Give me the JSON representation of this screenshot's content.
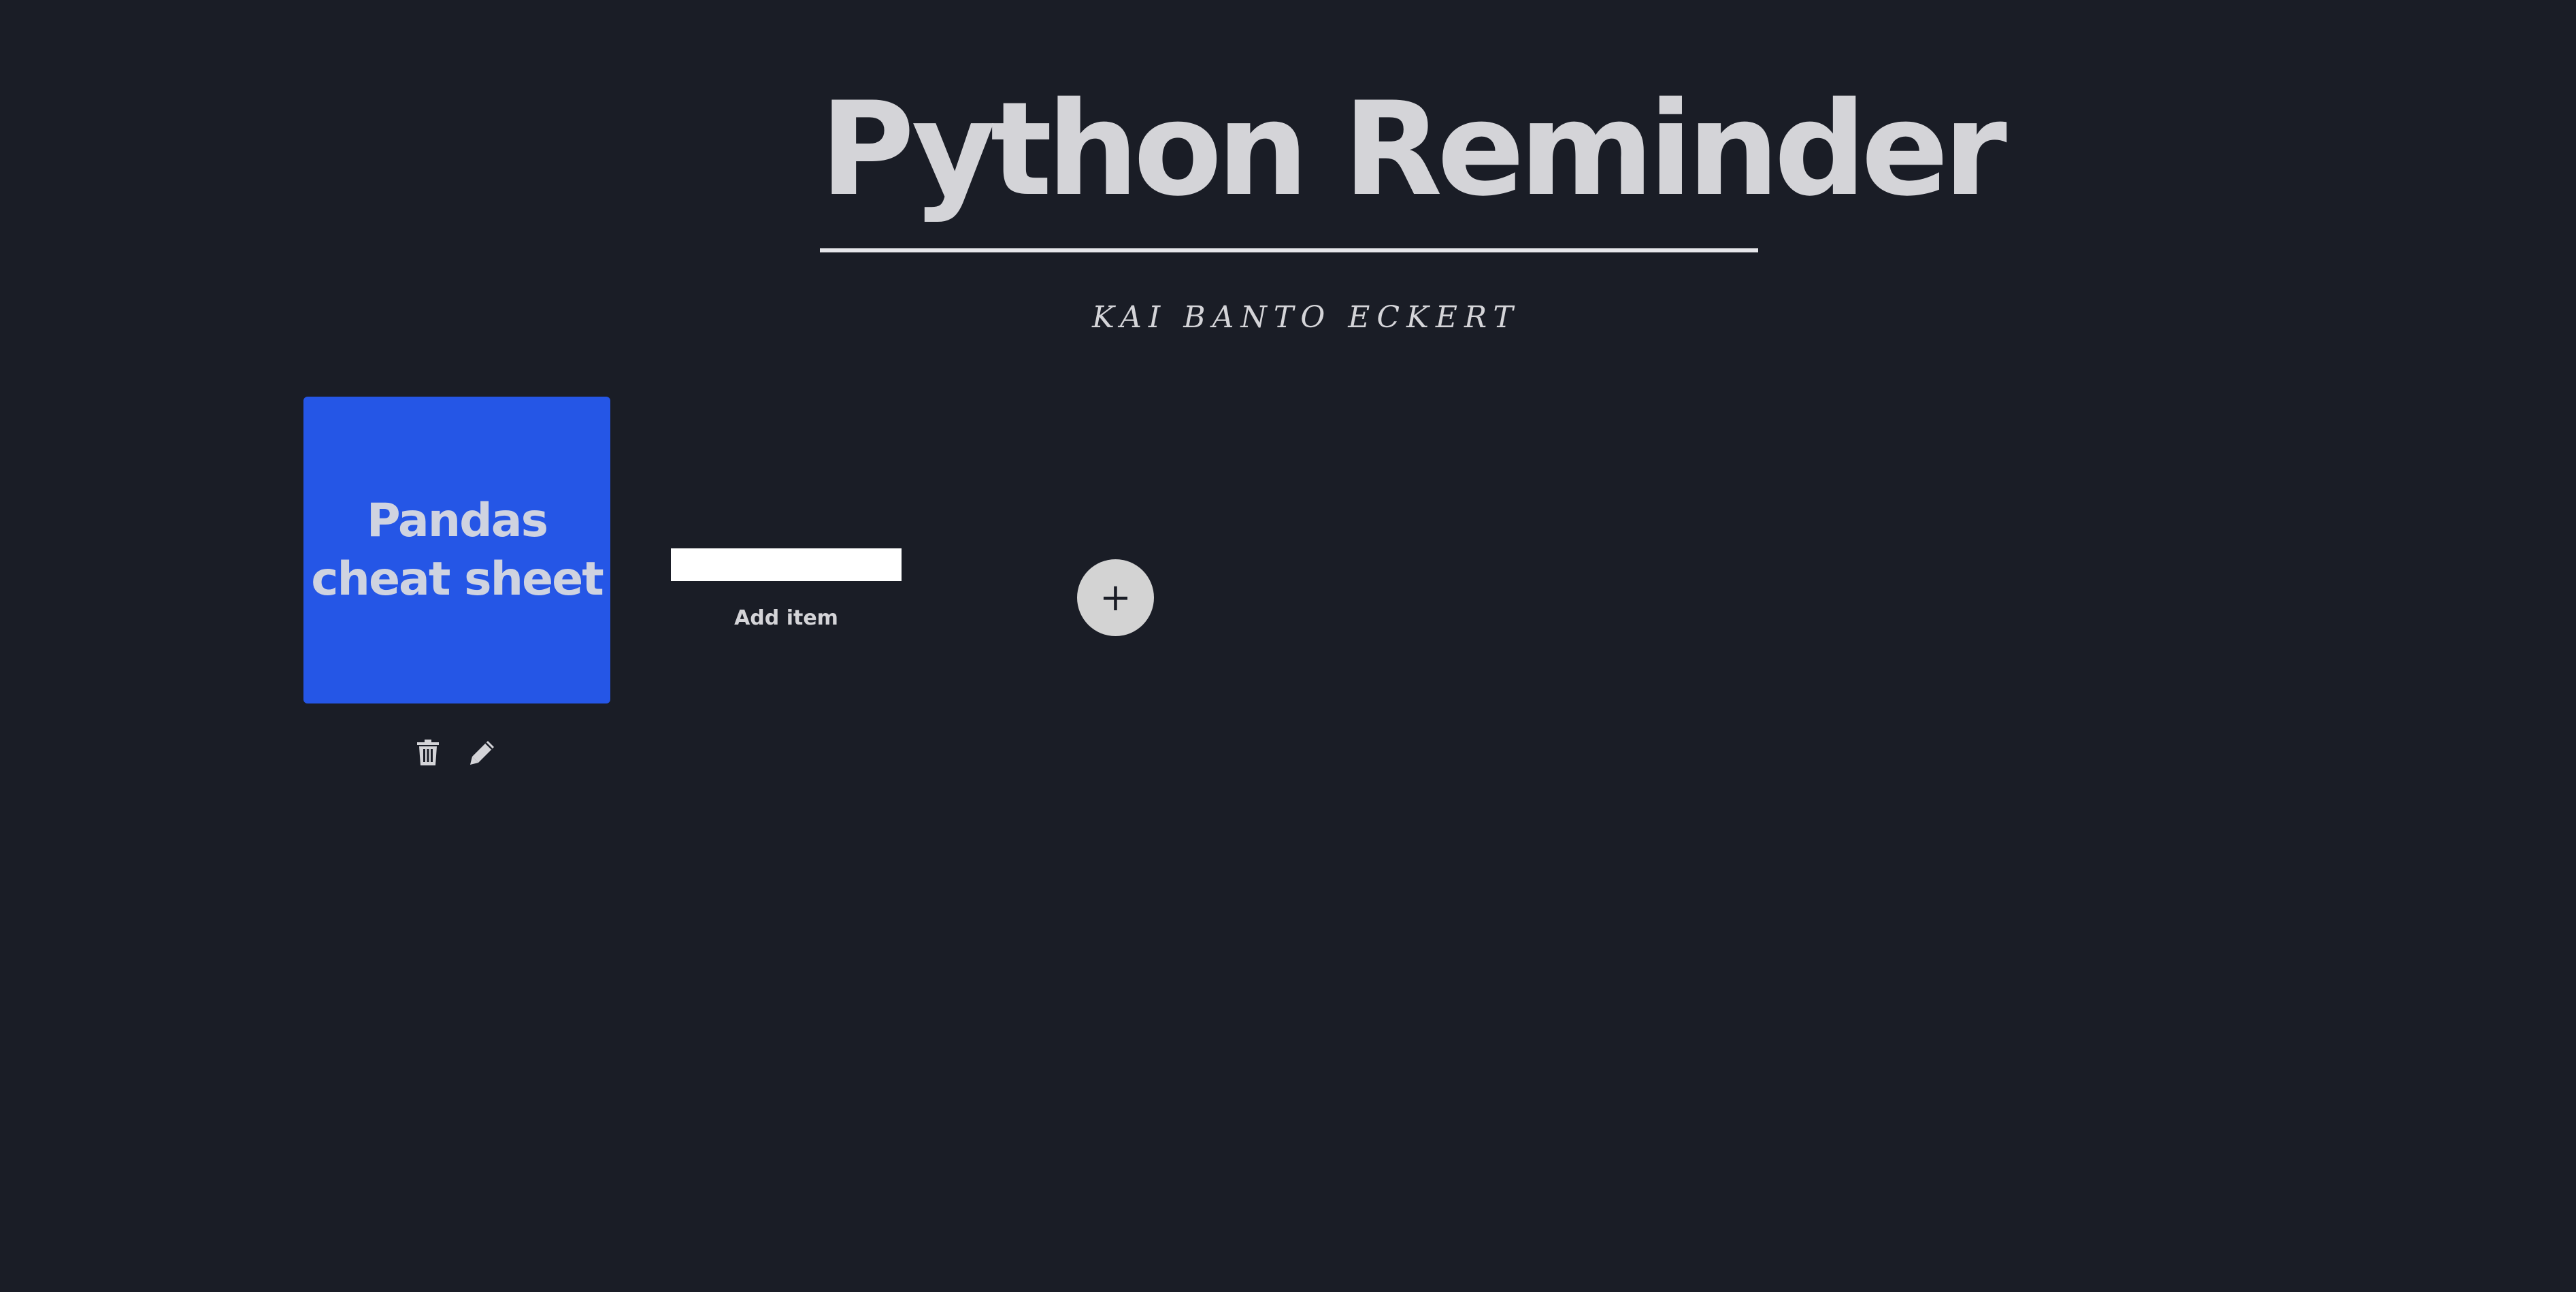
{
  "header": {
    "title": "Python Reminder",
    "author": "KAI BANTO ECKERT"
  },
  "cards": [
    {
      "title": "Pandas cheat sheet",
      "color": "#2556e6",
      "actions": {
        "delete_icon": "trash-icon",
        "edit_icon": "pencil-icon"
      }
    }
  ],
  "add_item": {
    "input_value": "",
    "label": "Add item"
  },
  "add_button": {
    "icon": "plus-icon",
    "glyph": "+"
  },
  "colors": {
    "background": "#1a1d26",
    "text": "#d4d4d8",
    "card_accent": "#2556e6",
    "button": "#d3d3d3"
  }
}
